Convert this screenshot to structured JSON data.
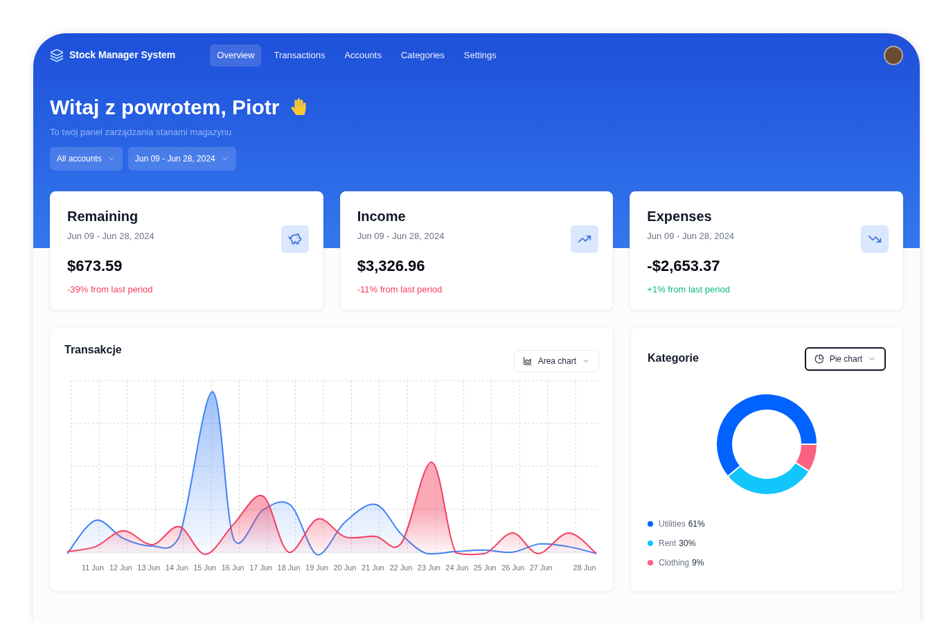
{
  "header": {
    "brand": "Stock Manager System",
    "nav": [
      {
        "label": "Overview",
        "selected": true
      },
      {
        "label": "Transactions",
        "selected": false
      },
      {
        "label": "Accounts",
        "selected": false
      },
      {
        "label": "Categories",
        "selected": false
      },
      {
        "label": "Settings",
        "selected": false
      }
    ],
    "greeting": "Witaj z powrotem, Piotr",
    "subtitle": "To twój panel zarządzania stanami magazynu",
    "filters": [
      "All accounts",
      "Jun 09 - Jun 28, 2024"
    ]
  },
  "cards": [
    {
      "title": "Remaining",
      "period": "Jun 09 - Jun 28, 2024",
      "amount": "$673.59",
      "change": {
        "text": "-39% from last period",
        "color": "#f43f5e"
      }
    },
    {
      "title": "Income",
      "period": "Jun 09 - Jun 28, 2024",
      "amount": "$3,326.96",
      "change": {
        "text": "-11% from last period",
        "color": "#f43f5e"
      }
    },
    {
      "title": "Expenses",
      "period": "Jun 09 - Jun 28, 2024",
      "amount": "-$2,653.37",
      "change": {
        "text": "+1% from last period",
        "color": "#10b981"
      }
    }
  ],
  "transactions": {
    "title": "Transakcje",
    "view_menu": {
      "label": "Area chart",
      "focused": false
    },
    "x_labels": [
      "11 Jun",
      "12 Jun",
      "13 Jun",
      "14 Jun",
      "15 Jun",
      "16 Jun",
      "17 Jun",
      "18 Jun",
      "19 Jun",
      "20 Jun",
      "21 Jun",
      "22 Jun",
      "23 Jun",
      "24 Jun",
      "25 Jun",
      "26 Jun",
      "27 Jun",
      "28 Jun"
    ]
  },
  "categories": {
    "title": "Kategorie",
    "view_menu": {
      "label": "Pie chart",
      "focused": true
    },
    "chart_data": {
      "type": "donut",
      "categories": [
        "Utilities",
        "Rent",
        "Clothing"
      ],
      "values": [
        61,
        30,
        9
      ]
    },
    "legend": [
      {
        "share": "61%",
        "color": "#0062ff"
      },
      {
        "share": "30%",
        "color": "#12c5fb"
      },
      {
        "share": "9%",
        "color": "#fb6180"
      }
    ]
  }
}
